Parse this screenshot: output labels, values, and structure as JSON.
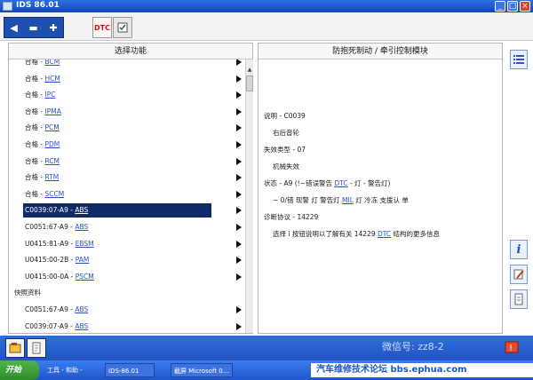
{
  "window": {
    "title": "IDS 86.01"
  },
  "toolbar": {
    "tool_dtc_label": "DTC"
  },
  "left_panel": {
    "header": "选择功能",
    "items": [
      {
        "prefix": "合格 - ",
        "link": "BCM",
        "kind": "item"
      },
      {
        "prefix": "合格 - ",
        "link": "HCM",
        "kind": "item"
      },
      {
        "prefix": "合格 - ",
        "link": "IPC",
        "kind": "item"
      },
      {
        "prefix": "合格 - ",
        "link": "IPMA",
        "kind": "item"
      },
      {
        "prefix": "合格 - ",
        "link": "PCM",
        "kind": "item"
      },
      {
        "prefix": "合格 - ",
        "link": "PDM",
        "kind": "item"
      },
      {
        "prefix": "合格 - ",
        "link": "RCM",
        "kind": "item"
      },
      {
        "prefix": "合格 - ",
        "link": "RTM",
        "kind": "item"
      },
      {
        "prefix": "合格 - ",
        "link": "SCCM",
        "kind": "item"
      },
      {
        "prefix": "C0039:07-A9 - ",
        "link": "ABS",
        "kind": "selected"
      },
      {
        "prefix": "C0051:67-A9 - ",
        "link": "ABS",
        "kind": "item"
      },
      {
        "prefix": "U0415:81-A9 - ",
        "link": "EBSM",
        "kind": "item"
      },
      {
        "prefix": "U0415:00-2B - ",
        "link": "PAM",
        "kind": "item"
      },
      {
        "prefix": "U0415:00-0A - ",
        "link": "PSCM",
        "kind": "item"
      },
      {
        "prefix": "快照资料",
        "link": "",
        "kind": "section"
      },
      {
        "prefix": "C0051:67-A9 - ",
        "link": "ABS",
        "kind": "item"
      },
      {
        "prefix": "C0039:07-A9 - ",
        "link": "ABS",
        "kind": "item"
      }
    ]
  },
  "right_panel": {
    "header": "防抱死制动 / 牵引控制模块",
    "lines": [
      {
        "text": "说明 - C0039",
        "link": "",
        "after": ""
      },
      {
        "text": "右后音轮",
        "link": "",
        "after": ""
      },
      {
        "text": "失效类型 - 07",
        "link": "",
        "after": ""
      },
      {
        "text": "机械失效",
        "link": "",
        "after": ""
      },
      {
        "text": "状态 - A9 (!~错误警告 ",
        "link": "DTC",
        "after": " - 灯  - 警告灯) "
      },
      {
        "text": "~ 0/错   现警  灯  警告灯 ",
        "link": "MIL",
        "after": " 灯  冷冻  支援认 单"
      },
      {
        "text": "诊断协议 - 14229",
        "link": "",
        "after": ""
      },
      {
        "text": "选择 i 按钮说明以了解有关 14229 ",
        "link": "DTC",
        "after": " 结构的更多信息"
      }
    ]
  },
  "bottom": {
    "watermark": "微信号: zz8-2"
  },
  "taskbar": {
    "start": "开始",
    "quick": "工具 - 和助 -",
    "item1": "IDS-86.01",
    "item2": "截屏 Microsoft 0...",
    "forum": "汽车维修技术论坛 bbs.ephua.com"
  }
}
